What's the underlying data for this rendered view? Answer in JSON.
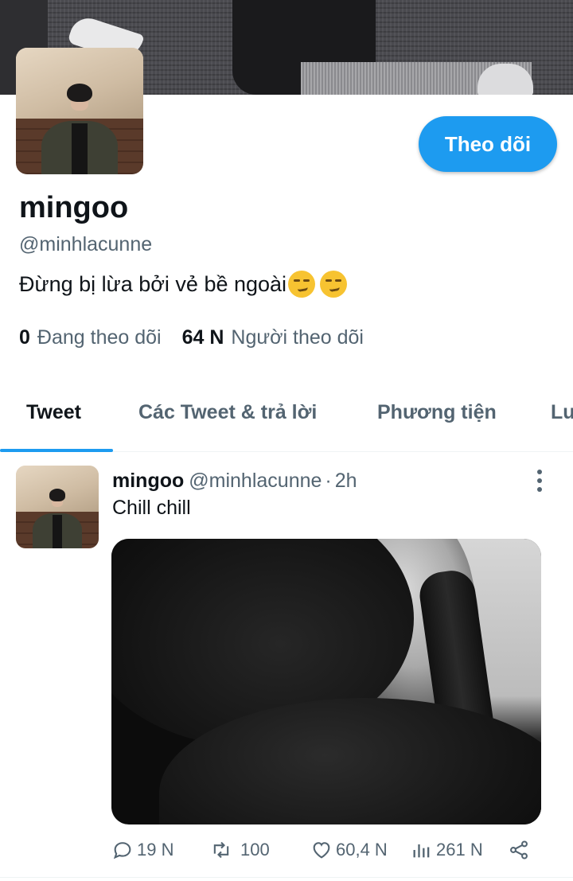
{
  "profile": {
    "display_name": "mingoo",
    "handle": "@minhlacunne",
    "bio": "Đừng bị lừa bởi vẻ bề ngoài",
    "bio_emoji": [
      "smirking-face",
      "smirking-face"
    ],
    "follow_button_label": "Theo dõi",
    "following_count": "0",
    "following_label": "Đang theo dõi",
    "followers_count": "64 N",
    "followers_label": "Người theo dõi"
  },
  "tabs": [
    {
      "label": "Tweet",
      "active": true
    },
    {
      "label": "Các Tweet & trả lời",
      "active": false
    },
    {
      "label": "Phương tiện",
      "active": false
    },
    {
      "label": "Lu",
      "active": false
    }
  ],
  "tweet": {
    "name": "mingoo",
    "handle": "@minhlacunne",
    "separator": "·",
    "time": "2h",
    "text": "Chill chill",
    "replies": "19 N",
    "retweets": "100",
    "likes": "60,4 N",
    "views": "261 N",
    "icons": [
      "reply-icon",
      "retweet-icon",
      "like-icon",
      "views-icon",
      "share-icon"
    ]
  },
  "colors": {
    "accent": "#1d9bf0",
    "text_primary": "#0f1419",
    "text_secondary": "#536471"
  }
}
